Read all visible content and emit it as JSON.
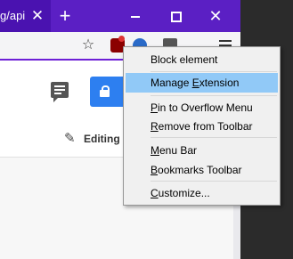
{
  "browser": {
    "tab": {
      "title": "g/api",
      "close_glyph": "✕"
    },
    "new_tab_glyph": "+",
    "window_controls": {
      "close_glyph": "✕"
    },
    "toolbar": {
      "bookmark_glyph": "☆"
    }
  },
  "page": {
    "editing_label": "Editing",
    "pencil_glyph": "✎"
  },
  "context_menu": {
    "items": [
      {
        "label": "Block element"
      },
      {
        "label": "Manage Extension",
        "mnemonic_prefix": "Manage ",
        "mnemonic": "E",
        "mnemonic_rest": "xtension",
        "highlighted": true
      },
      {
        "label": "Pin to Overflow Menu",
        "mnemonic_prefix": "",
        "mnemonic": "P",
        "mnemonic_rest": "in to Overflow Menu"
      },
      {
        "label": "Remove from Toolbar",
        "mnemonic_prefix": "",
        "mnemonic": "R",
        "mnemonic_rest": "emove from Toolbar"
      },
      {
        "label": "Menu Bar",
        "mnemonic_prefix": "",
        "mnemonic": "M",
        "mnemonic_rest": "enu Bar"
      },
      {
        "label": "Bookmarks Toolbar",
        "mnemonic_prefix": "",
        "mnemonic": "B",
        "mnemonic_rest": "ookmarks Toolbar"
      },
      {
        "label": "Customize...",
        "mnemonic_prefix": "",
        "mnemonic": "C",
        "mnemonic_rest": "ustomize..."
      }
    ]
  },
  "colors": {
    "titlebar": "#5b1fc4",
    "menu_highlight": "#91c9f7",
    "lock_button": "#2d7ff0"
  }
}
